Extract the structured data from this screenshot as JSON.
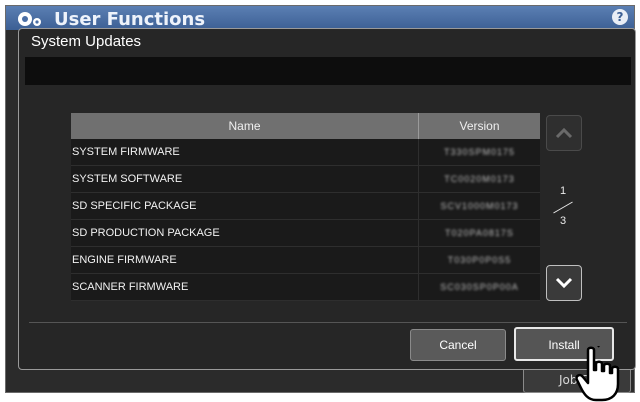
{
  "background": {
    "title": "User Functions",
    "help_label": "?",
    "job_button_label": "Job S"
  },
  "dialog": {
    "title": "System Updates",
    "table": {
      "headers": {
        "name": "Name",
        "version": "Version"
      },
      "rows": [
        {
          "name": "SYSTEM FIRMWARE",
          "version": "T330SPM0175"
        },
        {
          "name": "SYSTEM SOFTWARE",
          "version": "TC0020M0173"
        },
        {
          "name": "SD SPECIFIC PACKAGE",
          "version": "SCV1000M0173"
        },
        {
          "name": "SD PRODUCTION PACKAGE",
          "version": "T020PA0817S"
        },
        {
          "name": "ENGINE FIRMWARE",
          "version": "T030P0P0S5"
        },
        {
          "name": "SCANNER FIRMWARE",
          "version": "SC030SP0P00A"
        }
      ]
    },
    "pager": {
      "current": "1",
      "total": "3"
    },
    "buttons": {
      "cancel": "Cancel",
      "install": "Install"
    }
  },
  "colors": {
    "header_blue": "#4a6ea5",
    "dialog_bg": "#262626",
    "table_header": "#707070"
  },
  "icons": [
    "gear-icon",
    "help-icon",
    "chevron-up-icon",
    "chevron-down-icon",
    "pointing-hand-icon"
  ]
}
